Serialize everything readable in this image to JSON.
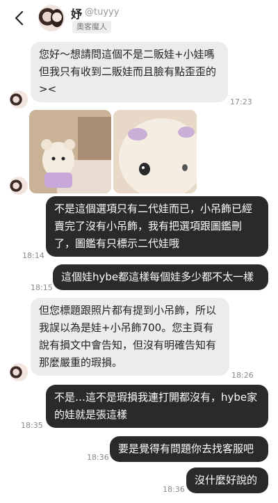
{
  "header": {
    "name": "妤",
    "handle": "@tuyyy",
    "badge": "奧客魔人"
  },
  "messages": [
    {
      "dir": "in",
      "text": "您好～想請問這個不是二販娃+小娃嗎但我只有收到二販娃而且臉有點歪歪的><",
      "time": "17:23"
    },
    {
      "dir": "in",
      "type": "images",
      "count": 2
    },
    {
      "dir": "out",
      "text": "不是這個選項只有二代娃而已，小吊飾已經賣完了沒有小吊飾，我有把選項跟圖鑑刪了，圖鑑有只標示二代娃哦",
      "time": "18:14"
    },
    {
      "dir": "out",
      "text": "這個娃hybe都這樣每個娃多少都不太一樣",
      "time": "18:15"
    },
    {
      "dir": "in",
      "text": "但您標題跟照片都有提到小吊飾，所以我誤以為是娃+小吊飾700。您主頁有說有損文中會告知，但沒有明確告知有那麼嚴重的瑕損。",
      "time": "18:26"
    },
    {
      "dir": "out",
      "text": "不是…這不是瑕損我連打開都沒有，hybe家的娃就是張這樣",
      "time": "18:35"
    },
    {
      "dir": "out",
      "text": "要是覺得有問題你去找客服吧",
      "time": "18:36"
    },
    {
      "dir": "out",
      "text": "沒什麼好說的",
      "time": "18:36"
    }
  ]
}
